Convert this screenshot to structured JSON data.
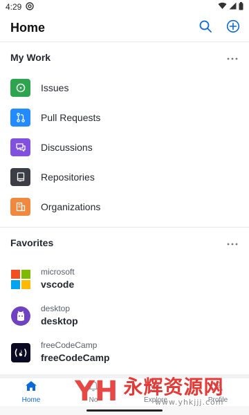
{
  "status_bar": {
    "time": "4:29",
    "icons": [
      "at-sign-icon",
      "wifi-icon",
      "signal-icon",
      "battery-icon"
    ]
  },
  "header": {
    "title": "Home",
    "icons": [
      "search-icon",
      "add-circle-icon"
    ]
  },
  "my_work": {
    "title": "My Work",
    "items": [
      {
        "label": "Issues",
        "icon": "issue-icon",
        "color": "#2da44e"
      },
      {
        "label": "Pull Requests",
        "icon": "pull-request-icon",
        "color": "#218bff"
      },
      {
        "label": "Discussions",
        "icon": "discussion-icon",
        "color": "#8250df"
      },
      {
        "label": "Repositories",
        "icon": "repo-icon",
        "color": "#3b3f45"
      },
      {
        "label": "Organizations",
        "icon": "organization-icon",
        "color": "#f0883e"
      }
    ]
  },
  "favorites": {
    "title": "Favorites",
    "items": [
      {
        "owner": "microsoft",
        "repo": "vscode",
        "avatar": "microsoft-logo-icon"
      },
      {
        "owner": "desktop",
        "repo": "desktop",
        "avatar": "github-desktop-logo-icon"
      },
      {
        "owner": "freeCodeCamp",
        "repo": "freeCodeCamp",
        "avatar": "freecodecamp-logo-icon"
      }
    ]
  },
  "tabs": [
    {
      "label": "Home",
      "icon": "home-icon",
      "active": true
    },
    {
      "label": "No",
      "icon": "bell-icon",
      "active": false
    },
    {
      "label": "Explore",
      "icon": "telescope-icon",
      "active": false
    },
    {
      "label": "Profile",
      "icon": "person-icon",
      "active": false
    }
  ],
  "watermark": {
    "mark": "YH",
    "text": "永辉资源网",
    "url": "www.yhkjjj.com"
  },
  "colors": {
    "accent": "#0969da",
    "watermark": "#e53935"
  }
}
